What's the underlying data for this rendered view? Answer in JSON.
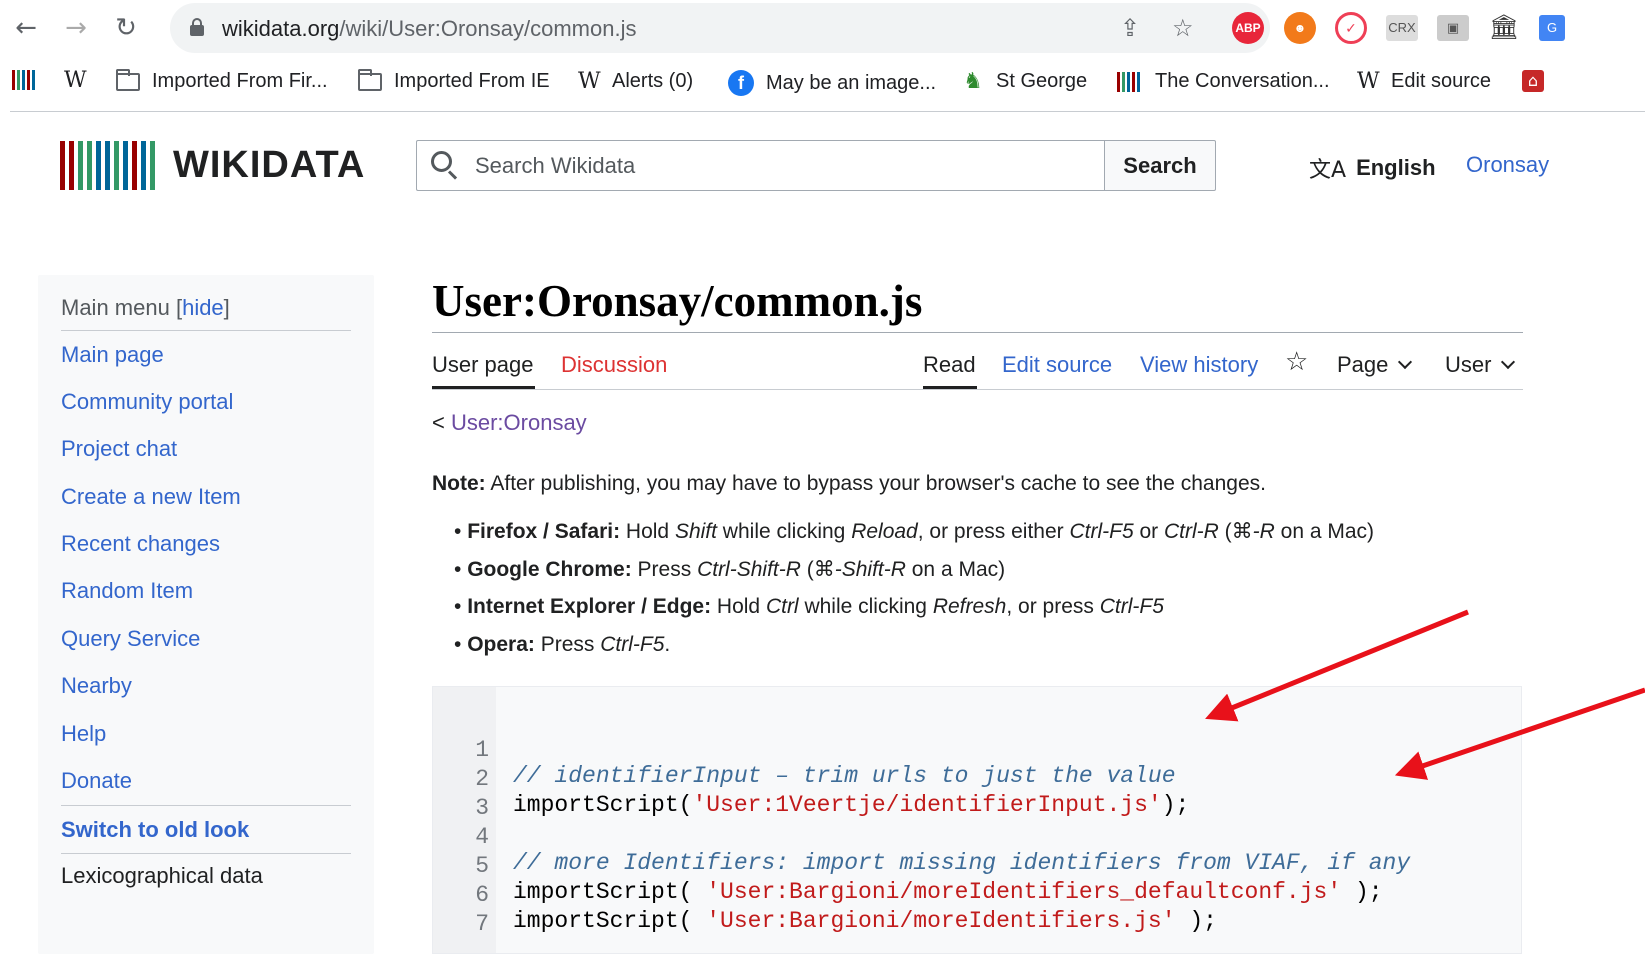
{
  "browser": {
    "url_host": "wikidata.org",
    "url_path": "/wiki/User:Oronsay/common.js",
    "extensions": [
      "ABP",
      "CRX"
    ],
    "bookmarks": [
      {
        "label": "",
        "icon": "barcode-icon"
      },
      {
        "label": "",
        "icon": "wikipedia-w-icon"
      },
      {
        "label": "Imported From Fir...",
        "icon": "folder-icon"
      },
      {
        "label": "Imported From IE",
        "icon": "folder-icon"
      },
      {
        "label": "Alerts (0)",
        "icon": "wikipedia-w-icon"
      },
      {
        "label": "May be an image...",
        "icon": "facebook-icon"
      },
      {
        "label": "St George",
        "icon": "st-george-icon"
      },
      {
        "label": "The Conversation...",
        "icon": "barcode-icon"
      },
      {
        "label": "Edit source",
        "icon": "wikipedia-w-icon"
      }
    ]
  },
  "header": {
    "logo_text": "WIKIDATA",
    "search_placeholder": "Search Wikidata",
    "search_button": "Search",
    "language": "English",
    "user": "Oronsay"
  },
  "sidebar": {
    "title": "Main menu",
    "hide_label": "hide",
    "items": [
      "Main page",
      "Community portal",
      "Project chat",
      "Create a new Item",
      "Recent changes",
      "Random Item",
      "Query Service",
      "Nearby",
      "Help",
      "Donate",
      "Switch to old look",
      "Lexicographical data"
    ]
  },
  "page": {
    "title": "User:Oronsay/common.js",
    "tabs": {
      "user_page": "User page",
      "discussion": "Discussion",
      "read": "Read",
      "edit_source": "Edit source",
      "view_history": "View history",
      "page_menu": "Page",
      "user_menu": "User"
    },
    "back_prefix": "< ",
    "back_link": "User:Oronsay",
    "note_label": "Note:",
    "note_text": " After publishing, you may have to bypass your browser's cache to see the changes."
  },
  "code": {
    "lines": [
      {
        "n": "1",
        "comment": "// identifierInput – trim urls to just the value"
      },
      {
        "n": "2",
        "fn": "importScript(",
        "str": "'User:1Veertje/identifierInput.js'",
        "end": ");"
      },
      {
        "n": "3"
      },
      {
        "n": "4",
        "comment": "// more Identifiers: import missing identifiers from VIAF, if any"
      },
      {
        "n": "5",
        "fn": "importScript( ",
        "str": "'User:Bargioni/moreIdentifiers_defaultconf.js'",
        "end": " );"
      },
      {
        "n": "6",
        "fn": "importScript( ",
        "str": "'User:Bargioni/moreIdentifiers.js'",
        "end": " );"
      },
      {
        "n": "7"
      }
    ]
  },
  "colors": {
    "link": "#3366cc",
    "visited": "#6b4ba1",
    "red_link": "#dd3333",
    "arrow": "#e8111a"
  }
}
